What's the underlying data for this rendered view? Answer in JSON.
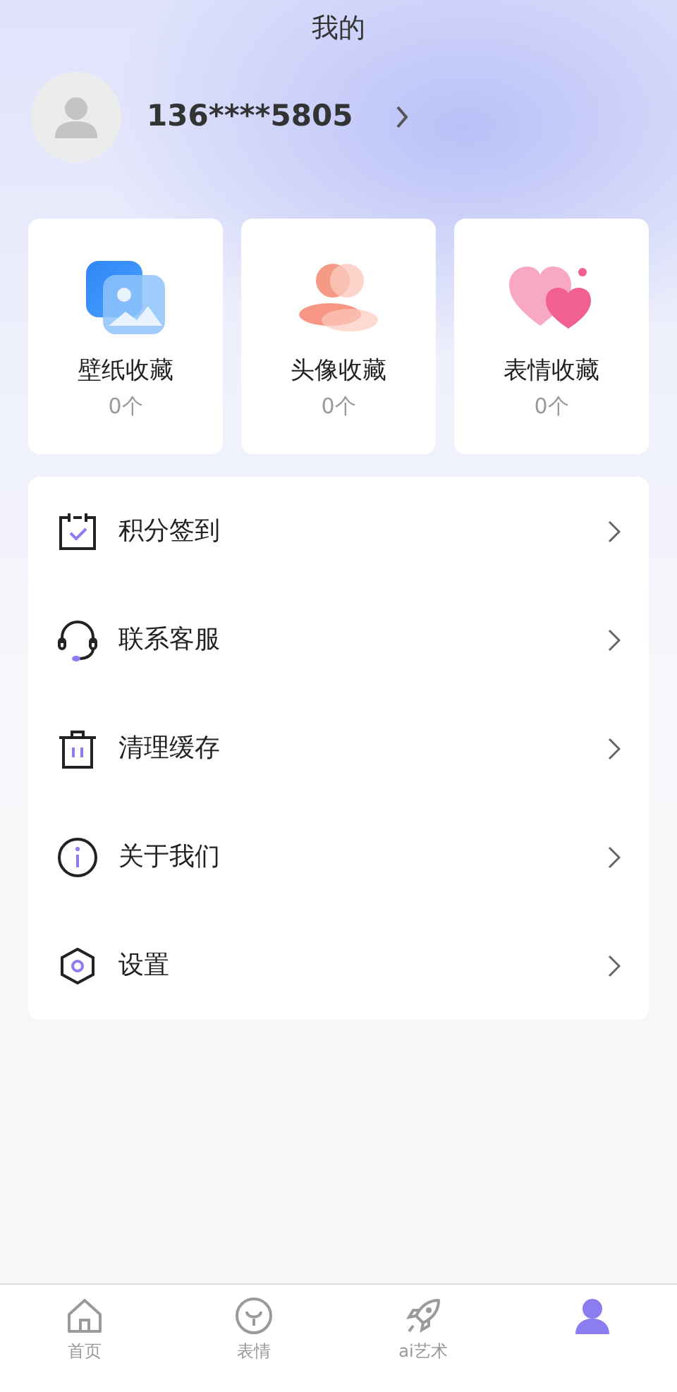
{
  "header": {
    "title": "我的"
  },
  "profile": {
    "phone": "136****5805"
  },
  "collections": [
    {
      "label": "壁纸收藏",
      "count": "0个"
    },
    {
      "label": "头像收藏",
      "count": "0个"
    },
    {
      "label": "表情收藏",
      "count": "0个"
    }
  ],
  "menu": [
    {
      "label": "积分签到"
    },
    {
      "label": "联系客服"
    },
    {
      "label": "清理缓存"
    },
    {
      "label": "关于我们"
    },
    {
      "label": "设置"
    }
  ],
  "tabs": [
    {
      "label": "首页",
      "selected": false
    },
    {
      "label": "表情",
      "selected": false
    },
    {
      "label": "ai艺术",
      "selected": false
    },
    {
      "selected": true
    }
  ]
}
